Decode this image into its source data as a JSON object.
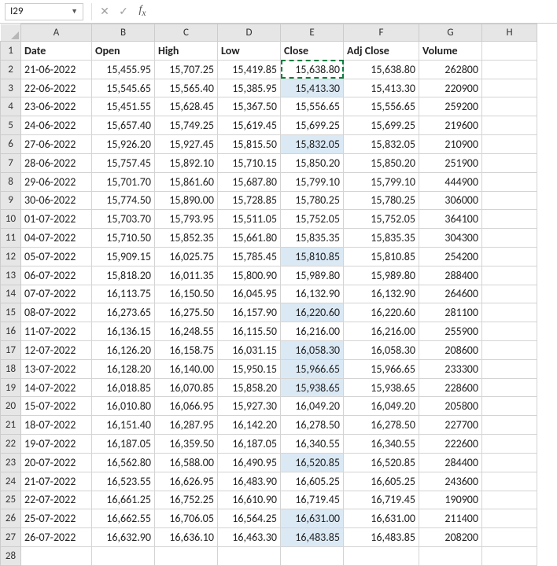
{
  "namebox": "I29",
  "formula": "",
  "columns": [
    "A",
    "B",
    "C",
    "D",
    "E",
    "F",
    "G",
    "H"
  ],
  "headers": [
    "Date",
    "Open",
    "High",
    "Low",
    "Close",
    "Adj Close",
    "Volume"
  ],
  "highlighted_close_rows": [
    3,
    6,
    12,
    15,
    17,
    18,
    19,
    23,
    26,
    27
  ],
  "copied_cell": {
    "row": 2,
    "col": 5
  },
  "rows": [
    {
      "n": 2,
      "date": "21-06-2022",
      "open": "15,455.95",
      "high": "15,707.25",
      "low": "15,419.85",
      "close": "15,638.80",
      "adj": "15,638.80",
      "vol": "262800"
    },
    {
      "n": 3,
      "date": "22-06-2022",
      "open": "15,545.65",
      "high": "15,565.40",
      "low": "15,385.95",
      "close": "15,413.30",
      "adj": "15,413.30",
      "vol": "220900"
    },
    {
      "n": 4,
      "date": "23-06-2022",
      "open": "15,451.55",
      "high": "15,628.45",
      "low": "15,367.50",
      "close": "15,556.65",
      "adj": "15,556.65",
      "vol": "259200"
    },
    {
      "n": 5,
      "date": "24-06-2022",
      "open": "15,657.40",
      "high": "15,749.25",
      "low": "15,619.45",
      "close": "15,699.25",
      "adj": "15,699.25",
      "vol": "219600"
    },
    {
      "n": 6,
      "date": "27-06-2022",
      "open": "15,926.20",
      "high": "15,927.45",
      "low": "15,815.50",
      "close": "15,832.05",
      "adj": "15,832.05",
      "vol": "210900"
    },
    {
      "n": 7,
      "date": "28-06-2022",
      "open": "15,757.45",
      "high": "15,892.10",
      "low": "15,710.15",
      "close": "15,850.20",
      "adj": "15,850.20",
      "vol": "251900"
    },
    {
      "n": 8,
      "date": "29-06-2022",
      "open": "15,701.70",
      "high": "15,861.60",
      "low": "15,687.80",
      "close": "15,799.10",
      "adj": "15,799.10",
      "vol": "444900"
    },
    {
      "n": 9,
      "date": "30-06-2022",
      "open": "15,774.50",
      "high": "15,890.00",
      "low": "15,728.85",
      "close": "15,780.25",
      "adj": "15,780.25",
      "vol": "306000"
    },
    {
      "n": 10,
      "date": "01-07-2022",
      "open": "15,703.70",
      "high": "15,793.95",
      "low": "15,511.05",
      "close": "15,752.05",
      "adj": "15,752.05",
      "vol": "364100"
    },
    {
      "n": 11,
      "date": "04-07-2022",
      "open": "15,710.50",
      "high": "15,852.35",
      "low": "15,661.80",
      "close": "15,835.35",
      "adj": "15,835.35",
      "vol": "304300"
    },
    {
      "n": 12,
      "date": "05-07-2022",
      "open": "15,909.15",
      "high": "16,025.75",
      "low": "15,785.45",
      "close": "15,810.85",
      "adj": "15,810.85",
      "vol": "254200"
    },
    {
      "n": 13,
      "date": "06-07-2022",
      "open": "15,818.20",
      "high": "16,011.35",
      "low": "15,800.90",
      "close": "15,989.80",
      "adj": "15,989.80",
      "vol": "288400"
    },
    {
      "n": 14,
      "date": "07-07-2022",
      "open": "16,113.75",
      "high": "16,150.50",
      "low": "16,045.95",
      "close": "16,132.90",
      "adj": "16,132.90",
      "vol": "264600"
    },
    {
      "n": 15,
      "date": "08-07-2022",
      "open": "16,273.65",
      "high": "16,275.50",
      "low": "16,157.90",
      "close": "16,220.60",
      "adj": "16,220.60",
      "vol": "281100"
    },
    {
      "n": 16,
      "date": "11-07-2022",
      "open": "16,136.15",
      "high": "16,248.55",
      "low": "16,115.50",
      "close": "16,216.00",
      "adj": "16,216.00",
      "vol": "255900"
    },
    {
      "n": 17,
      "date": "12-07-2022",
      "open": "16,126.20",
      "high": "16,158.75",
      "low": "16,031.15",
      "close": "16,058.30",
      "adj": "16,058.30",
      "vol": "208600"
    },
    {
      "n": 18,
      "date": "13-07-2022",
      "open": "16,128.20",
      "high": "16,140.00",
      "low": "15,950.15",
      "close": "15,966.65",
      "adj": "15,966.65",
      "vol": "233300"
    },
    {
      "n": 19,
      "date": "14-07-2022",
      "open": "16,018.85",
      "high": "16,070.85",
      "low": "15,858.20",
      "close": "15,938.65",
      "adj": "15,938.65",
      "vol": "228600"
    },
    {
      "n": 20,
      "date": "15-07-2022",
      "open": "16,010.80",
      "high": "16,066.95",
      "low": "15,927.30",
      "close": "16,049.20",
      "adj": "16,049.20",
      "vol": "205800"
    },
    {
      "n": 21,
      "date": "18-07-2022",
      "open": "16,151.40",
      "high": "16,287.95",
      "low": "16,142.20",
      "close": "16,278.50",
      "adj": "16,278.50",
      "vol": "227700"
    },
    {
      "n": 22,
      "date": "19-07-2022",
      "open": "16,187.05",
      "high": "16,359.50",
      "low": "16,187.05",
      "close": "16,340.55",
      "adj": "16,340.55",
      "vol": "222600"
    },
    {
      "n": 23,
      "date": "20-07-2022",
      "open": "16,562.80",
      "high": "16,588.00",
      "low": "16,490.95",
      "close": "16,520.85",
      "adj": "16,520.85",
      "vol": "284400"
    },
    {
      "n": 24,
      "date": "21-07-2022",
      "open": "16,523.55",
      "high": "16,626.95",
      "low": "16,483.90",
      "close": "16,605.25",
      "adj": "16,605.25",
      "vol": "243600"
    },
    {
      "n": 25,
      "date": "22-07-2022",
      "open": "16,661.25",
      "high": "16,752.25",
      "low": "16,610.90",
      "close": "16,719.45",
      "adj": "16,719.45",
      "vol": "190900"
    },
    {
      "n": 26,
      "date": "25-07-2022",
      "open": "16,662.55",
      "high": "16,706.05",
      "low": "16,564.25",
      "close": "16,631.00",
      "adj": "16,631.00",
      "vol": "211400"
    },
    {
      "n": 27,
      "date": "26-07-2022",
      "open": "16,632.90",
      "high": "16,636.10",
      "low": "16,463.30",
      "close": "16,483.85",
      "adj": "16,483.85",
      "vol": "208200"
    }
  ]
}
